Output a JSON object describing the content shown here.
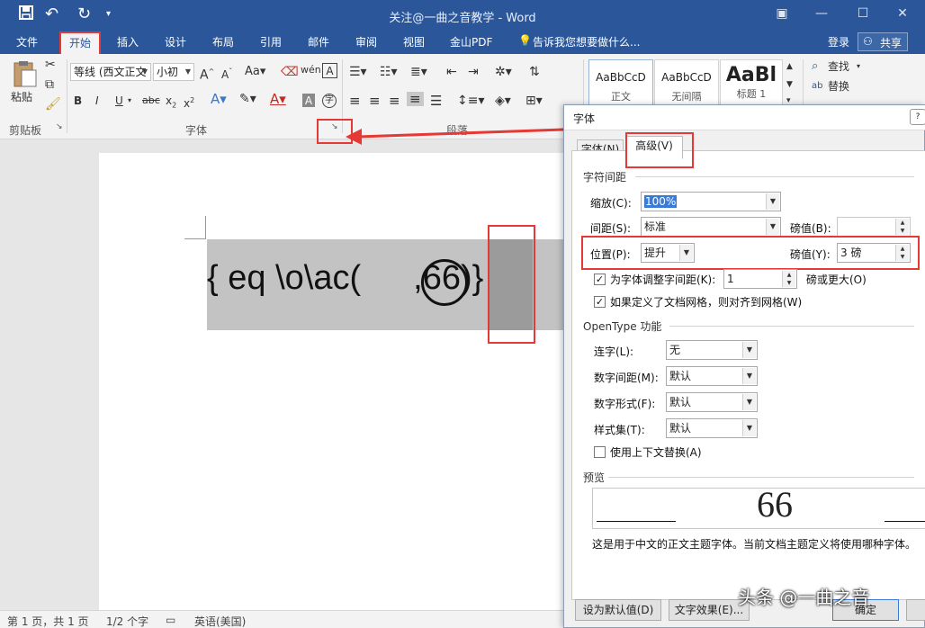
{
  "titlebar": {
    "title": "关注@一曲之音教学 - Word",
    "qa_icons": [
      "save-icon",
      "undo-icon",
      "redo-icon",
      "customize-icon"
    ]
  },
  "tabs": [
    "文件",
    "开始",
    "插入",
    "设计",
    "布局",
    "引用",
    "邮件",
    "审阅",
    "视图",
    "金山PDF"
  ],
  "tell_me": "告诉我您想要做什么...",
  "login": "登录",
  "share": "共享",
  "ribbon": {
    "paste": "粘贴",
    "clipboard_group": "剪贴板",
    "font_group": "字体",
    "para_group": "段落",
    "font_name": "等线 (西文正文",
    "font_size": "小初",
    "styles": [
      {
        "sample": "AaBbCcD",
        "name": "正文"
      },
      {
        "sample": "AaBbCcD",
        "name": "无间隔"
      },
      {
        "sample": "AaBl",
        "name": "标题 1"
      }
    ],
    "find": "查找",
    "replace": "替换"
  },
  "document": {
    "field_text": "{ eq \\o\\ac(",
    "field_after": ",",
    "field_num": "66",
    "field_end": ")}"
  },
  "status": {
    "page": "第 1 页，共 1 页",
    "words": "1/2 个字",
    "lang": "英语(美国)"
  },
  "dialog": {
    "title": "字体",
    "tabs": [
      "字体(N)",
      "高级(V)"
    ],
    "spacing_section": "字符间距",
    "scale_label": "缩放(C):",
    "scale_value": "100%",
    "spacing_label": "间距(S):",
    "spacing_value": "标准",
    "by_label": "磅值(B):",
    "by_value": "",
    "position_label": "位置(P):",
    "position_value": "提升",
    "by2_label": "磅值(Y):",
    "by2_value": "3 磅",
    "kern_label": "为字体调整字间距(K):",
    "kern_value": "1",
    "kern_after": "磅或更大(O)",
    "snap_label": "如果定义了文档网格，则对齐到网格(W)",
    "opentype_section": "OpenType 功能",
    "ligatures_label": "连字(L):",
    "ligatures_value": "无",
    "numspacing_label": "数字间距(M):",
    "numspacing_value": "默认",
    "numforms_label": "数字形式(F):",
    "numforms_value": "默认",
    "stylesets_label": "样式集(T):",
    "stylesets_value": "默认",
    "contextual_label": "使用上下文替换(A)",
    "preview_section": "预览",
    "preview_text": "66",
    "preview_note": "这是用于中文的正文主题字体。当前文档主题定义将使用哪种字体。",
    "default_btn": "设为默认值(D)",
    "effects_btn": "文字效果(E)...",
    "ok_btn": "确定"
  },
  "watermark": "头条 @一曲之音"
}
